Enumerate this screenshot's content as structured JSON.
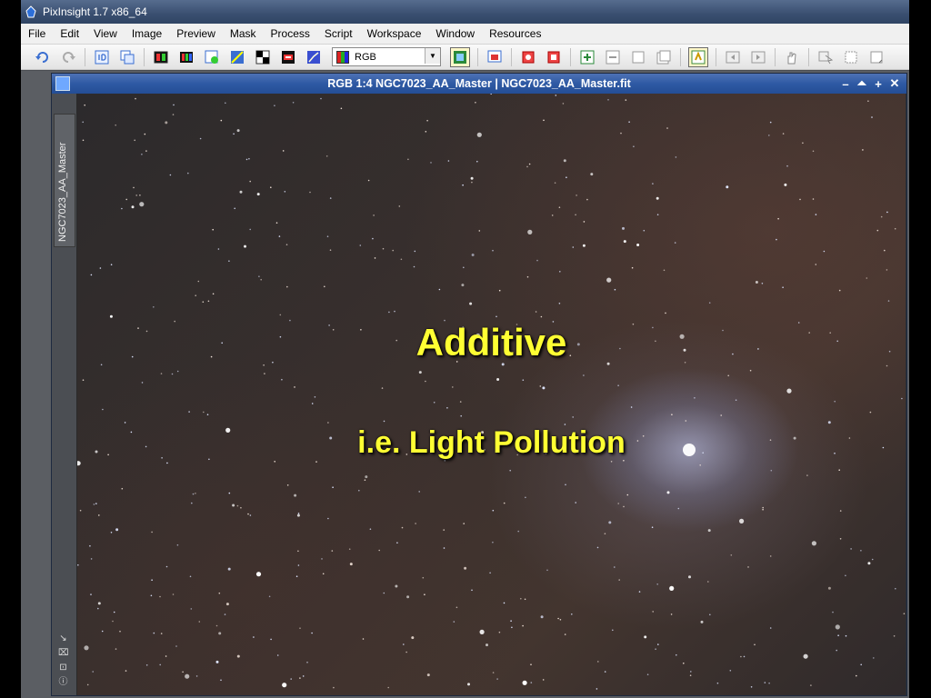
{
  "app": {
    "title": "PixInsight 1.7 x86_64"
  },
  "menu": [
    "File",
    "Edit",
    "View",
    "Image",
    "Preview",
    "Mask",
    "Process",
    "Script",
    "Workspace",
    "Window",
    "Resources"
  ],
  "toolbar": {
    "color_mode": "RGB"
  },
  "image_window": {
    "title": "RGB 1:4 NGC7023_AA_Master | NGC7023_AA_Master.fit",
    "side_tab_label": "NGC7023_AA_Master"
  },
  "overlay": {
    "main_text": "Additive",
    "sub_text": "i.e. Light Pollution"
  },
  "colors": {
    "caption": "#ffff33",
    "window_title_bar": "#2f5aa4"
  },
  "icons": [
    "undo-icon",
    "redo-icon",
    "identifier-icon",
    "clone-icon",
    "new-image-icon",
    "rgb-channels-icon",
    "new-preview-icon",
    "star-mask-icon",
    "invert-icon",
    "swap-icon",
    "statistics-icon",
    "stf-icon",
    "zoom-in-icon",
    "zoom-out-icon",
    "fit-view-icon",
    "hand-tool-icon"
  ]
}
